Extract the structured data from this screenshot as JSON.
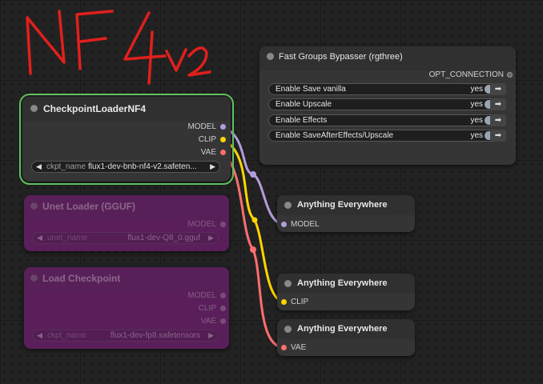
{
  "annotation": {
    "text": "NF4v2",
    "color": "#e0201c"
  },
  "colors": {
    "model": "#b39ddb",
    "clip": "#ffd500",
    "vae": "#ff6e6e",
    "selected": "#5fbf5f",
    "muted_node": "#5a1f5a"
  },
  "checkpoint_loader": {
    "title": "CheckpointLoaderNF4",
    "outputs": [
      "MODEL",
      "CLIP",
      "VAE"
    ],
    "widget": {
      "name": "ckpt_name",
      "value": "flux1-dev-bnb-nf4-v2.safeten..."
    }
  },
  "unet_loader": {
    "title": "Unet Loader (GGUF)",
    "outputs": [
      "MODEL"
    ],
    "widget": {
      "name": "unet_name",
      "value": "flux1-dev-Q8_0.gguf"
    }
  },
  "load_checkpoint": {
    "title": "Load Checkpoint",
    "outputs": [
      "MODEL",
      "CLIP",
      "VAE"
    ],
    "widget": {
      "name": "ckpt_name",
      "value": "flux1-dev-fp8.safetensors"
    }
  },
  "bypasser": {
    "title": "Fast Groups Bypasser (rgthree)",
    "output": "OPT_CONNECTION",
    "rows": [
      {
        "label": "Enable Save vanilla",
        "value": "yes"
      },
      {
        "label": "Enable Upscale",
        "value": "yes"
      },
      {
        "label": "Enable Effects",
        "value": "yes"
      },
      {
        "label": "Enable SaveAfterEffects/Upscale",
        "value": "yes"
      }
    ],
    "go_icon": "arrow-right-icon"
  },
  "anything_everywhere": [
    {
      "title": "Anything Everywhere",
      "input": "MODEL"
    },
    {
      "title": "Anything Everywhere",
      "input": "CLIP"
    },
    {
      "title": "Anything Everywhere",
      "input": "VAE"
    }
  ]
}
